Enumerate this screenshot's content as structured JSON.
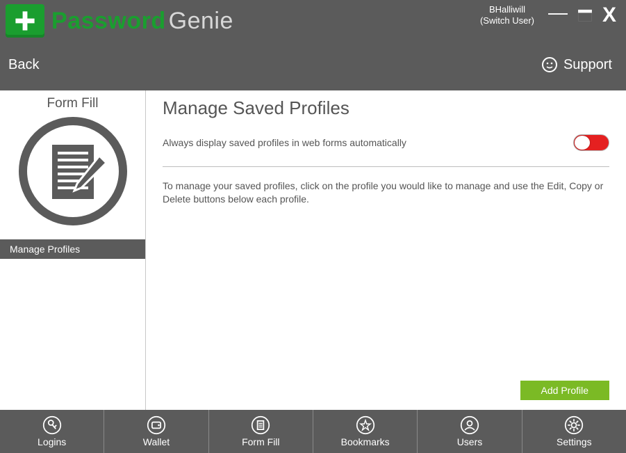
{
  "brand": {
    "bold": "Password",
    "light": "Genie"
  },
  "user": {
    "name": "BHalliwill",
    "switch": "(Switch User)"
  },
  "header": {
    "back": "Back",
    "support": "Support"
  },
  "sidebar": {
    "title": "Form Fill",
    "items": [
      {
        "label": "Manage Profiles"
      }
    ]
  },
  "content": {
    "heading": "Manage Saved Profiles",
    "toggle_label": "Always display saved profiles in web forms automatically",
    "toggle_on": false,
    "description": "To manage your saved profiles, click on the profile you would like to manage and use the Edit, Copy or Delete buttons below each profile.",
    "add_button": "Add Profile"
  },
  "bottomnav": [
    {
      "label": "Logins"
    },
    {
      "label": "Wallet"
    },
    {
      "label": "Form Fill"
    },
    {
      "label": "Bookmarks"
    },
    {
      "label": "Users"
    },
    {
      "label": "Settings"
    }
  ]
}
